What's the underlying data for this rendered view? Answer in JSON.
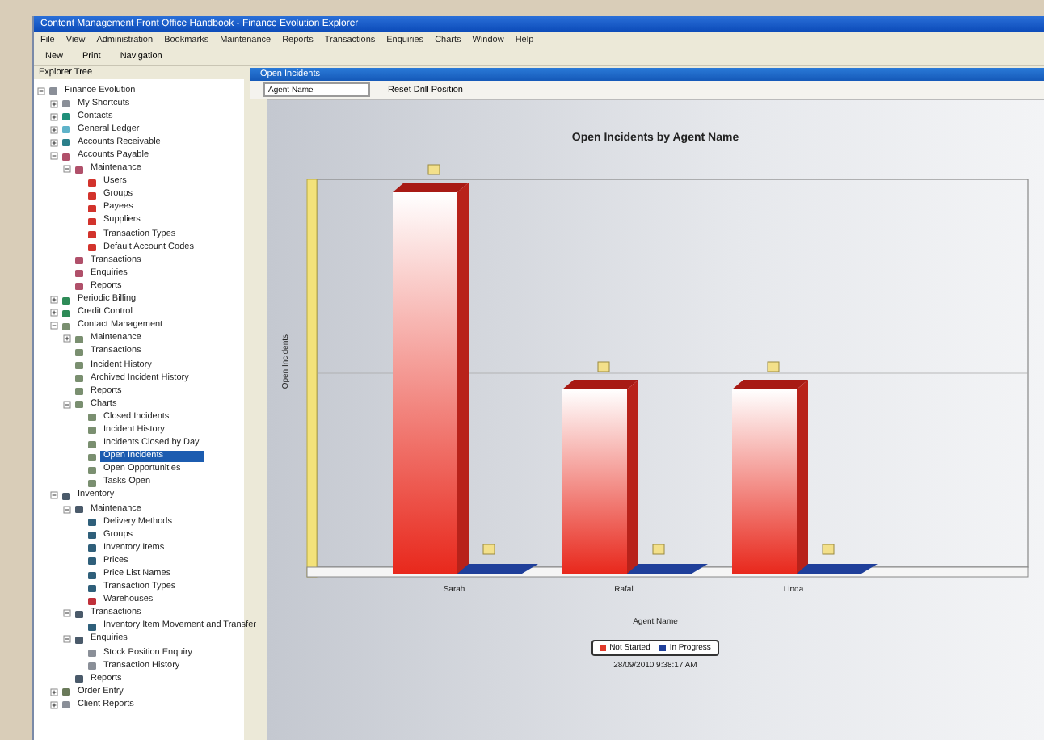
{
  "window": {
    "title": "Content Management Front Office Handbook - Finance Evolution Explorer"
  },
  "menu": [
    "File",
    "View",
    "Administration",
    "Bookmarks",
    "Maintenance",
    "Reports",
    "Transactions",
    "Enquiries",
    "Charts",
    "Window",
    "Help"
  ],
  "toolbar": {
    "buttons": [
      "New",
      "Print"
    ],
    "navigation": "Navigation"
  },
  "explorer": {
    "title": "Explorer Tree",
    "tree": [
      {
        "label": "Finance Evolution",
        "expanded": true,
        "selected": false,
        "color": "#8a8f98",
        "children": [
          {
            "label": "My Shortcuts",
            "expanded": false,
            "selected": false,
            "color": "#8a8f98"
          },
          {
            "label": "Contacts",
            "expanded": false,
            "selected": false,
            "color": "#1f8f7a"
          },
          {
            "label": "General Ledger",
            "expanded": false,
            "selected": false,
            "color": "#5fb3c9"
          },
          {
            "label": "Accounts Receivable",
            "expanded": false,
            "selected": false,
            "color": "#2b7f8a"
          },
          {
            "label": "Accounts Payable",
            "expanded": true,
            "selected": false,
            "color": "#b0506a",
            "children": [
              {
                "label": "Maintenance",
                "expanded": true,
                "selected": false,
                "color": "#b0506a",
                "children": [
                  {
                    "label": "Users",
                    "selected": false,
                    "color": "#d2332c"
                  },
                  {
                    "label": "Groups",
                    "selected": false,
                    "color": "#d2332c"
                  },
                  {
                    "label": "Payees",
                    "selected": false,
                    "color": "#d2332c"
                  },
                  {
                    "label": "Suppliers",
                    "selected": false,
                    "color": "#d2332c"
                  },
                  {
                    "label": "Transaction Types",
                    "selected": false,
                    "color": "#d2332c"
                  },
                  {
                    "label": "Default Account Codes",
                    "selected": false,
                    "color": "#d2332c"
                  }
                ]
              },
              {
                "label": "Transactions",
                "selected": false,
                "color": "#b0506a"
              },
              {
                "label": "Enquiries",
                "selected": false,
                "color": "#b0506a"
              },
              {
                "label": "Reports",
                "selected": false,
                "color": "#b0506a"
              }
            ]
          },
          {
            "label": "Periodic Billing",
            "expanded": false,
            "selected": false,
            "color": "#2e8b57"
          },
          {
            "label": "Credit Control",
            "expanded": false,
            "selected": false,
            "color": "#2e8b57"
          },
          {
            "label": "Contact Management",
            "expanded": true,
            "selected": false,
            "color": "#7a8f70",
            "children": [
              {
                "label": "Maintenance",
                "expanded": false,
                "selected": false,
                "color": "#7a8f70"
              },
              {
                "label": "Transactions",
                "selected": false,
                "color": "#7a8f70"
              },
              {
                "label": "Incident History",
                "selected": false,
                "color": "#7a8f70"
              },
              {
                "label": "Archived Incident History",
                "selected": false,
                "color": "#7a8f70"
              },
              {
                "label": "Reports",
                "selected": false,
                "color": "#7a8f70"
              },
              {
                "label": "Charts",
                "expanded": true,
                "selected": false,
                "color": "#7a8f70",
                "children": [
                  {
                    "label": "Closed Incidents",
                    "selected": false,
                    "color": "#7a8f70"
                  },
                  {
                    "label": "Incident History",
                    "selected": false,
                    "color": "#7a8f70"
                  },
                  {
                    "label": "Incidents Closed by Day",
                    "selected": false,
                    "color": "#7a8f70"
                  },
                  {
                    "label": "Open Incidents",
                    "selected": true,
                    "color": "#7a8f70"
                  },
                  {
                    "label": "Open Opportunities",
                    "selected": false,
                    "color": "#7a8f70"
                  },
                  {
                    "label": "Tasks Open",
                    "selected": false,
                    "color": "#7a8f70"
                  }
                ]
              }
            ]
          },
          {
            "label": "Inventory",
            "expanded": true,
            "selected": false,
            "color": "#4a5a6a",
            "children": [
              {
                "label": "Maintenance",
                "expanded": true,
                "selected": false,
                "color": "#4a5a6a",
                "children": [
                  {
                    "label": "Delivery Methods",
                    "selected": false,
                    "color": "#2f5f7a"
                  },
                  {
                    "label": "Groups",
                    "selected": false,
                    "color": "#2f5f7a"
                  },
                  {
                    "label": "Inventory Items",
                    "selected": false,
                    "color": "#2f5f7a"
                  },
                  {
                    "label": "Prices",
                    "selected": false,
                    "color": "#2f5f7a"
                  },
                  {
                    "label": "Price List Names",
                    "selected": false,
                    "color": "#2f5f7a"
                  },
                  {
                    "label": "Transaction Types",
                    "selected": false,
                    "color": "#2f5f7a"
                  },
                  {
                    "label": "Warehouses",
                    "selected": false,
                    "color": "#c0303a"
                  }
                ]
              },
              {
                "label": "Transactions",
                "expanded": true,
                "selected": false,
                "color": "#4a5a6a",
                "children": [
                  {
                    "label": "Inventory Item Movement and Transfer",
                    "selected": false,
                    "color": "#2f5f7a"
                  }
                ]
              },
              {
                "label": "Enquiries",
                "expanded": true,
                "selected": false,
                "color": "#4a5a6a",
                "children": [
                  {
                    "label": "Stock Position Enquiry",
                    "selected": false,
                    "color": "#8a8f98"
                  },
                  {
                    "label": "Transaction History",
                    "selected": false,
                    "color": "#8a8f98"
                  }
                ]
              },
              {
                "label": "Reports",
                "selected": false,
                "color": "#4a5a6a"
              }
            ]
          },
          {
            "label": "Order Entry",
            "expanded": false,
            "selected": false,
            "color": "#6a7a5a"
          },
          {
            "label": "Client Reports",
            "expanded": false,
            "selected": false,
            "color": "#8a8f98"
          }
        ]
      }
    ]
  },
  "document": {
    "title": "Open Incidents",
    "grouping": "Agent Name",
    "reset": "Reset Drill Position",
    "chart": {
      "title": "Open Incidents by Agent Name",
      "ylabel": "Open Incidents",
      "xlabel": "Agent Name",
      "categories": [
        "Sarah",
        "Rafal",
        "Linda"
      ],
      "legend": [
        {
          "label": "Not Started",
          "color": "#e03a2a"
        },
        {
          "label": "In Progress",
          "color": "#1f3f9a"
        }
      ],
      "timestamp": "28/09/2010 9:38:17 AM"
    }
  }
}
